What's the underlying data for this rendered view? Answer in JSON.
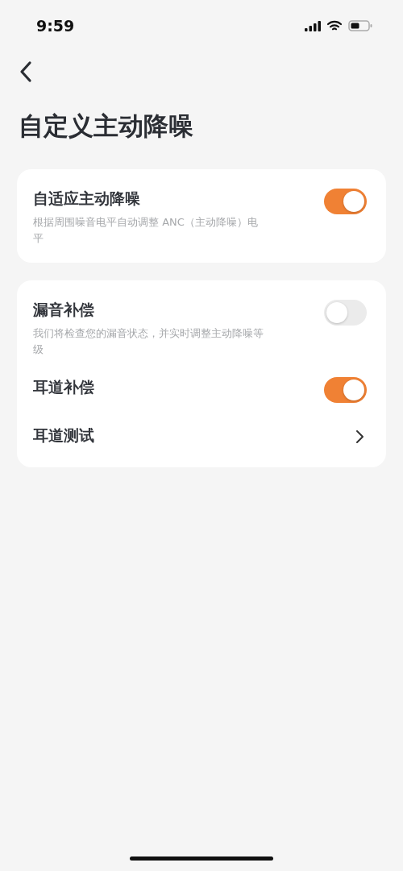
{
  "status_bar": {
    "time": "9:59"
  },
  "title": "自定义主动降噪",
  "cards": [
    {
      "rows": [
        {
          "kind": "toggle",
          "label": "自适应主动降噪",
          "description": "根据周围噪音电平自动调整 ANC（主动降噪）电平",
          "on": true
        }
      ]
    },
    {
      "rows": [
        {
          "kind": "toggle",
          "label": "漏音补偿",
          "description": "我们将检查您的漏音状态，并实时调整主动降噪等级",
          "on": false
        },
        {
          "kind": "toggle",
          "label": "耳道补偿",
          "on": true
        },
        {
          "kind": "link",
          "label": "耳道测试"
        }
      ]
    }
  ]
}
